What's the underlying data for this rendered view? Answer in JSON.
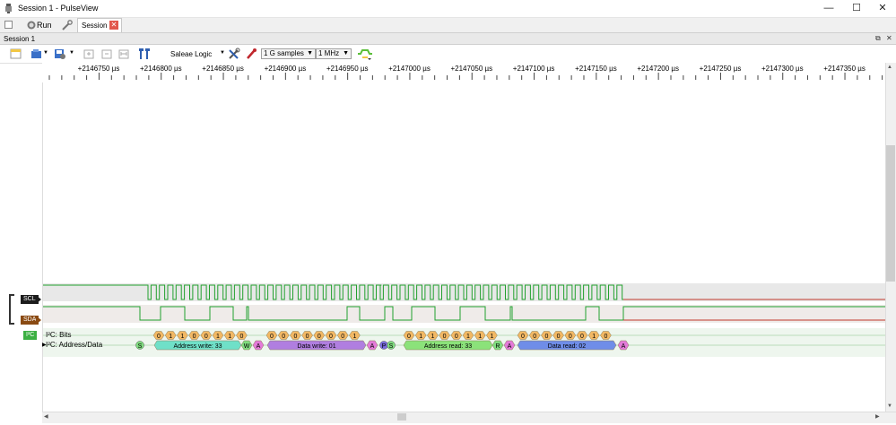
{
  "window": {
    "title": "Session 1 - PulseView",
    "minimize": "—",
    "maximize": "☐",
    "close": "✕"
  },
  "tabs": {
    "run_label": "Run",
    "session_tab_label": "Session 1",
    "session_header": "Session 1"
  },
  "toolbar": {
    "device": "Saleae Logic",
    "samples": "1 G samples",
    "rate": "1 MHz"
  },
  "ruler": {
    "ticks": [
      "+2146750 µs",
      "+2146800 µs",
      "+2146850 µs",
      "+2146900 µs",
      "+2146950 µs",
      "+2147000 µs",
      "+2147050 µs",
      "+2147100 µs",
      "+2147150 µs",
      "+2147200 µs",
      "+2147250 µs",
      "+2147300 µs",
      "+2147350 µs"
    ]
  },
  "channels": {
    "scl": "SCL",
    "sda": "SDA",
    "decoder_badge": "I²C",
    "bits_label": "I²C: Bits",
    "addr_label": "I²C: Address/Data"
  },
  "decoder": {
    "bits": [
      "0",
      "1",
      "1",
      "0",
      "0",
      "1",
      "1",
      "0",
      "0",
      "0",
      "0",
      "0",
      "0",
      "0",
      "0",
      "1",
      "0",
      "1",
      "1",
      "0",
      "0",
      "1",
      "1",
      "1",
      "0",
      "0",
      "0",
      "0",
      "0",
      "0",
      "1",
      "0"
    ],
    "annotations": {
      "start1": "S",
      "addr_write": "Address write: 33",
      "w": "W",
      "a1": "A",
      "data_write": "Data write: 01",
      "a2": "A",
      "p": "P",
      "start2": "S",
      "addr_read": "Address read: 33",
      "r": "R",
      "a3": "A",
      "data_read": "Data read: 02",
      "a4": "A"
    }
  },
  "colors": {
    "scl_high": "#22a02e",
    "scl_low": "#c0392b",
    "start": "#7fdc7f",
    "address": "#6fe0c8",
    "rw": "#7fdc7f",
    "ack": "#e47ad9",
    "data_write": "#b07ee0",
    "address_read": "#8be27a",
    "data_read": "#6f8de8",
    "stop": "#7a6de0",
    "bit": "#f2b864"
  }
}
